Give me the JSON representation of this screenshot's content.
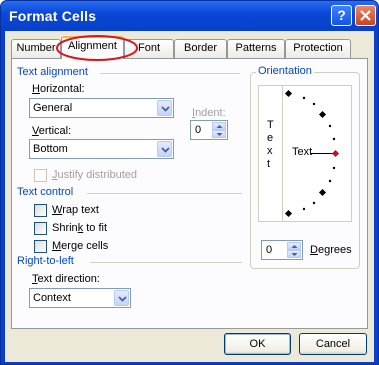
{
  "window": {
    "title": "Format Cells",
    "help_glyph": "?",
    "close_glyph": "X"
  },
  "tabs": [
    {
      "label": "Number"
    },
    {
      "label": "Alignment"
    },
    {
      "label": "Font"
    },
    {
      "label": "Border"
    },
    {
      "label": "Patterns"
    },
    {
      "label": "Protection"
    }
  ],
  "selected_tab": "Alignment",
  "text_alignment": {
    "group_label": "Text alignment",
    "horizontal_label_pre": "H",
    "horizontal_label_post": "orizontal:",
    "horizontal_value": "General",
    "vertical_label_pre": "V",
    "vertical_label_post": "ertical:",
    "vertical_value": "Bottom",
    "indent_label_pre": "I",
    "indent_label_post": "ndent:",
    "indent_value": "0",
    "justify_distributed_pre": "J",
    "justify_distributed_post": "ustify distributed"
  },
  "text_control": {
    "group_label": "Text control",
    "wrap_text_pre": "W",
    "wrap_text_post": "rap text",
    "shrink_pre": "Shrin",
    "shrink_u": "k",
    "shrink_post": " to fit",
    "merge_pre": "M",
    "merge_post": "erge cells"
  },
  "rtl": {
    "group_label": "Right-to-left",
    "direction_label_pre": "T",
    "direction_label_post": "ext direction:",
    "direction_value": "Context"
  },
  "orientation": {
    "group_label": "Orientation",
    "vertical_text": [
      "T",
      "e",
      "x",
      "t"
    ],
    "dial_text": "Text",
    "degrees_value": "0",
    "degrees_label_pre": "D",
    "degrees_label_post": "egrees"
  },
  "buttons": {
    "ok": "OK",
    "cancel": "Cancel"
  },
  "colors": {
    "annotation": "#d6191f",
    "group_label": "#0046d5",
    "titlebar": "#0a48d8"
  }
}
